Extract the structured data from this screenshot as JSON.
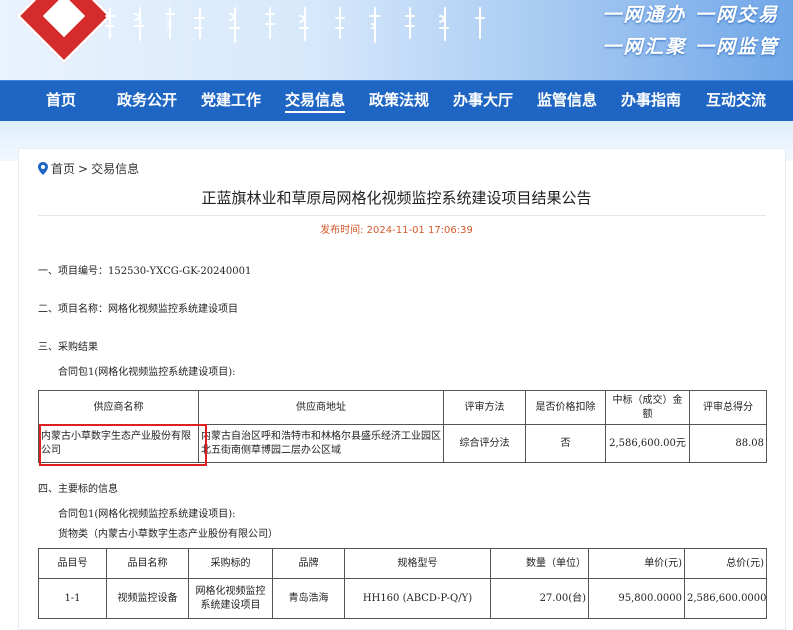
{
  "banner": {
    "slogan_line1": "一网通办  一网交易",
    "slogan_line2": "一网汇聚  一网监管"
  },
  "colors": {
    "nav_bg": "#1f66c4",
    "accent_red": "#e02020",
    "date_orange": "#d45a2a"
  },
  "nav": {
    "items": [
      {
        "label": "首页"
      },
      {
        "label": "政务公开"
      },
      {
        "label": "党建工作"
      },
      {
        "label": "交易信息"
      },
      {
        "label": "政策法规"
      },
      {
        "label": "办事大厅"
      },
      {
        "label": "监管信息"
      },
      {
        "label": "办事指南"
      },
      {
        "label": "互动交流"
      }
    ],
    "active": "交易信息"
  },
  "breadcrumb": {
    "icon": "location-pin-icon",
    "home": "首页",
    "sep": ">",
    "current": "交易信息"
  },
  "article": {
    "title": "正蓝旗林业和草原局网格化视频监控系统建设项目结果公告",
    "publish_label": "发布时间:",
    "publish_time": "2024-11-01 17:06:39",
    "sec1": "一、项目编号：152530-YXCG-GK-20240001",
    "sec2": "二、项目名称：网格化视频监控系统建设项目",
    "sec3": "三、采购结果",
    "sec3_sub": "合同包1(网格化视频监控系统建设项目):",
    "sec4": "四、主要标的信息",
    "sec4_sub1": "合同包1(网格化视频监控系统建设项目):",
    "sec4_sub2": "货物类（内蒙古小草数字生态产业股份有限公司）"
  },
  "result_table": {
    "headers": [
      "供应商名称",
      "供应商地址",
      "评审方法",
      "是否价格扣除",
      "中标（成交）金额",
      "评审总得分"
    ],
    "rows": [
      [
        "内蒙古小草数字生态产业股份有限公司",
        "内蒙古自治区呼和浩特市和林格尔县盛乐经济工业园区北五街南侧草博园二层办公区域",
        "综合评分法",
        "否",
        "2,586,600.00元",
        "88.08"
      ]
    ]
  },
  "goods_table": {
    "headers": [
      "品目号",
      "品目名称",
      "采购标的",
      "品牌",
      "规格型号",
      "数量（单位）",
      "单价(元)",
      "总价(元)"
    ],
    "rows": [
      [
        "1-1",
        "视频监控设备",
        "网格化视频监控系统建设项目",
        "青岛浩海",
        "HH160 (ABCD-P-Q/Y)",
        "27.00(台)",
        "95,800.0000",
        "2,586,600.0000"
      ]
    ]
  }
}
